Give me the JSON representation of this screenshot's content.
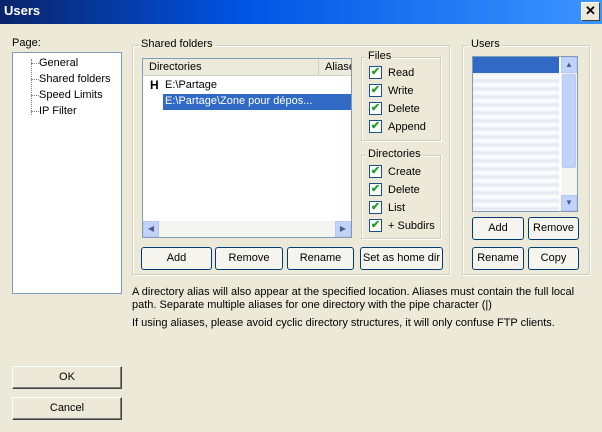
{
  "window": {
    "title": "Users",
    "close_glyph": "✕"
  },
  "page_panel": {
    "label": "Page:",
    "items": [
      "General",
      "Shared folders",
      "Speed Limits",
      "IP Filter"
    ]
  },
  "shared_folders": {
    "label": "Shared folders",
    "columns": [
      "Directories",
      "Aliases"
    ],
    "rows": [
      {
        "marker": "H",
        "path": "E:\\Partage",
        "selected": false
      },
      {
        "marker": "",
        "path": "E:\\Partage\\Zone pour dépos...",
        "selected": true
      }
    ],
    "buttons": {
      "add": "Add",
      "remove": "Remove",
      "rename": "Rename",
      "home": "Set as home dir"
    }
  },
  "files_group": {
    "label": "Files",
    "options": [
      {
        "label": "Read",
        "checked": true
      },
      {
        "label": "Write",
        "checked": true
      },
      {
        "label": "Delete",
        "checked": true
      },
      {
        "label": "Append",
        "checked": true
      }
    ]
  },
  "directories_group": {
    "label": "Directories",
    "options": [
      {
        "label": "Create",
        "checked": true
      },
      {
        "label": "Delete",
        "checked": true
      },
      {
        "label": "List",
        "checked": true
      },
      {
        "label": "+ Subdirs",
        "checked": true
      }
    ]
  },
  "users": {
    "label": "Users",
    "buttons": {
      "add": "Add",
      "remove": "Remove",
      "rename": "Rename",
      "copy": "Copy"
    }
  },
  "notes": {
    "alias_note": "A directory alias will also appear at the specified location. Aliases must contain the full local path. Separate multiple aliases for one directory with the pipe character (|)",
    "cyclic_note": "If using aliases, please avoid cyclic directory structures, it will only confuse FTP clients."
  },
  "dialog_buttons": {
    "ok": "OK",
    "cancel": "Cancel"
  },
  "check_glyph": "✔",
  "colors": {
    "title_bar": "#0054e3",
    "selection": "#316ac5",
    "dialog_bg": "#ece9d8"
  }
}
